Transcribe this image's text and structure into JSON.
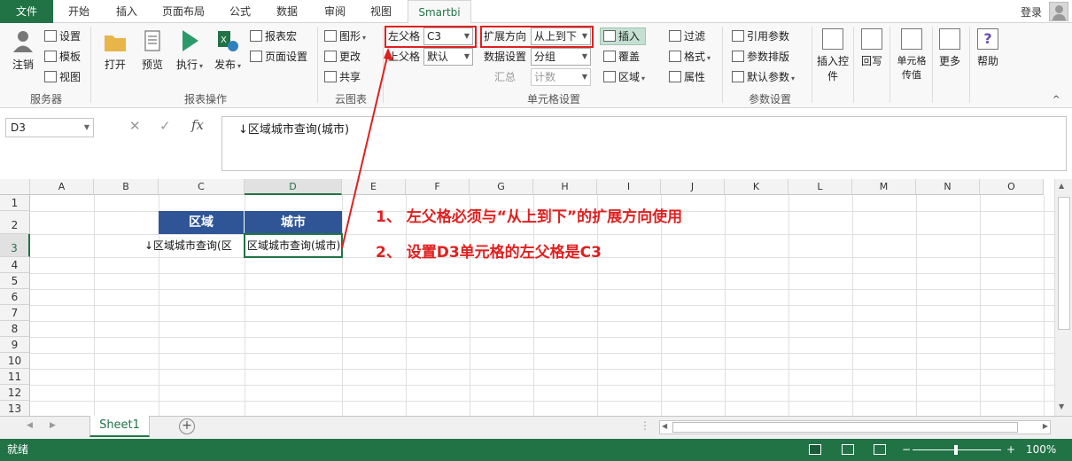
{
  "tabs": [
    "文件",
    "开始",
    "插入",
    "页面布局",
    "公式",
    "数据",
    "审阅",
    "视图",
    "Smartbi"
  ],
  "login": "登录",
  "ribbon": {
    "server": {
      "logout": "注销",
      "settings": "设置",
      "template": "模板",
      "view": "视图",
      "group": "服务器"
    },
    "report": {
      "open": "打开",
      "preview": "预览",
      "execute": "执行",
      "publish": "发布",
      "macro": "报表宏",
      "pagesetup": "页面设置",
      "group": "报表操作"
    },
    "cloud": {
      "chart": "图形",
      "update": "更改",
      "share": "共享",
      "group": "云图表"
    },
    "cell": {
      "left_parent_label": "左父格",
      "left_parent_value": "C3",
      "top_parent_label": "上父格",
      "top_parent_value": "默认",
      "expand_label": "扩展方向",
      "expand_value": "从上到下",
      "data_label": "数据设置",
      "data_value": "分组",
      "summary_label": "汇总",
      "summary_value": "计数",
      "insert": "插入",
      "cover": "覆盖",
      "area": "区域",
      "filter": "过滤",
      "format": "格式",
      "attr": "属性",
      "group": "单元格设置"
    },
    "param": {
      "ref": "引用参数",
      "layout": "参数排版",
      "default": "默认参数",
      "group": "参数设置"
    },
    "insertctl": "插入控件",
    "writeback": "回写",
    "cellvalue": "单元格传值",
    "more": "更多",
    "help": "帮助"
  },
  "formula_bar": {
    "name_box": "D3",
    "formula": "↓区域城市查询(城市)"
  },
  "columns": [
    "A",
    "B",
    "C",
    "D",
    "E",
    "F",
    "G",
    "H",
    "I",
    "J",
    "K",
    "L",
    "M",
    "N",
    "O"
  ],
  "rows": [
    "1",
    "2",
    "3",
    "4",
    "5",
    "6",
    "7",
    "8",
    "9",
    "10",
    "11",
    "12",
    "13"
  ],
  "cells": {
    "c2": "区域",
    "d2": "城市",
    "c3": "↓区域城市查询(区",
    "d3": "区域城市查询(城市)"
  },
  "annotations": [
    "1、 左父格必须与“从上到下”的扩展方向使用",
    "2、 设置D3单元格的左父格是C3"
  ],
  "sheet": {
    "name": "Sheet1"
  },
  "status": {
    "text": "就绪",
    "zoom": "100%"
  },
  "colors": {
    "accent": "#217346",
    "header": "#2f5597",
    "annotation": "#e02020"
  }
}
